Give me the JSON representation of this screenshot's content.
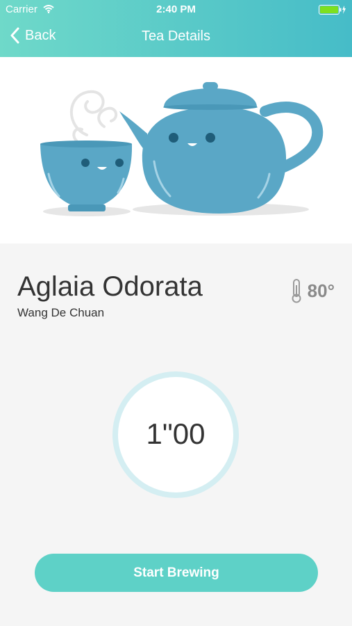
{
  "status_bar": {
    "carrier": "Carrier",
    "time": "2:40 PM"
  },
  "nav": {
    "back_label": "Back",
    "title": "Tea Details"
  },
  "tea": {
    "name": "Aglaia Odorata",
    "origin": "Wang De Chuan",
    "temperature": "80°"
  },
  "timer": {
    "display": "1\"00"
  },
  "actions": {
    "start_label": "Start Brewing"
  },
  "colors": {
    "accent": "#5ed1c7",
    "teapot": "#5aa7c6",
    "header_start": "#6fd9c9",
    "header_end": "#46bcc8",
    "timer_ring": "#d4eef2"
  },
  "icons": [
    "wifi-icon",
    "battery-icon",
    "back-chevron-icon",
    "thermometer-icon",
    "teacup-icon",
    "teapot-icon",
    "steam-icon"
  ]
}
